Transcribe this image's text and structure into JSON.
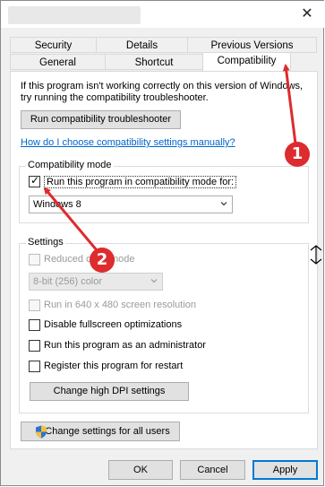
{
  "window": {
    "close_glyph": "✕"
  },
  "tabs_back": [
    "Security",
    "Details",
    "Previous Versions"
  ],
  "tabs_front": [
    "General",
    "Shortcut",
    "Compatibility"
  ],
  "intro": {
    "line1": "If this program isn't working correctly on this version of Windows,",
    "line2": "try running the compatibility troubleshooter."
  },
  "troubleshooter_button": "Run compatibility troubleshooter",
  "help_link": "How do I choose compatibility settings manually?",
  "compat_mode": {
    "legend": "Compatibility mode",
    "checkbox_label": "Run this program in compatibility mode for:",
    "checked": true,
    "selected_os": "Windows 8"
  },
  "settings": {
    "legend": "Settings",
    "reduced_color_label": "Reduced color mode",
    "color_select": "8-bit (256) color",
    "resolution_label": "Run in 640 x 480 screen resolution",
    "fullscreen_label": "Disable fullscreen optimizations",
    "admin_label": "Run this program as an administrator",
    "restart_label": "Register this program for restart",
    "dpi_button": "Change high DPI settings"
  },
  "all_users_button": "Change settings for all users",
  "footer": {
    "ok": "OK",
    "cancel": "Cancel",
    "apply": "Apply"
  },
  "annotations": {
    "badge1": "1",
    "badge2": "2",
    "color": "#dd2b2e"
  }
}
